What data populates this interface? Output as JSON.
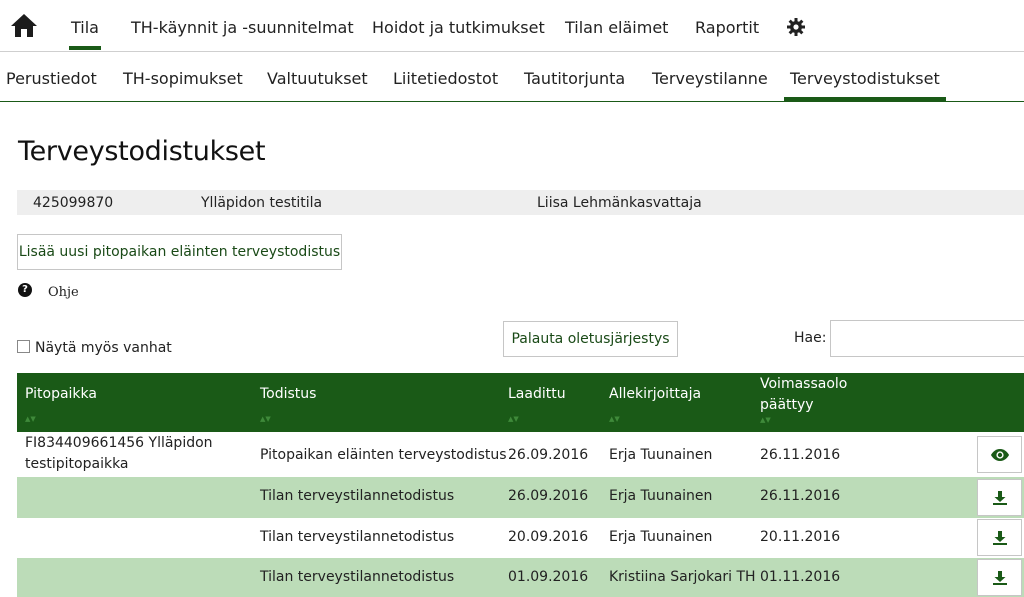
{
  "topnav": {
    "home_icon": "home-icon",
    "items": [
      {
        "label": "Tila",
        "active": true
      },
      {
        "label": "TH-käynnit ja -suunnitelmat"
      },
      {
        "label": "Hoidot ja tutkimukset"
      },
      {
        "label": "Tilan eläimet"
      },
      {
        "label": "Raportit"
      }
    ],
    "settings_icon": "gear-icon"
  },
  "subnav": {
    "items": [
      {
        "label": "Perustiedot"
      },
      {
        "label": "TH-sopimukset"
      },
      {
        "label": "Valtuutukset"
      },
      {
        "label": "Liitetiedostot"
      },
      {
        "label": "Tautitorjunta"
      },
      {
        "label": "Terveystilanne"
      },
      {
        "label": "Terveystodistukset",
        "active": true
      }
    ]
  },
  "page_title": "Terveystodistukset",
  "farm": {
    "id": "425099870",
    "name": "Ylläpidon testitila",
    "owner": "Liisa Lehmänkasvattaja"
  },
  "add_button": "Lisää uusi pitopaikan eläinten terveystodistus",
  "help": {
    "icon": "question-circle-icon",
    "label": "Ohje"
  },
  "show_old": {
    "label": "Näytä myös vanhat",
    "checked": false
  },
  "reset_button": "Palauta oletusjärjestys",
  "search": {
    "label": "Hae:",
    "value": ""
  },
  "table": {
    "headers": {
      "location": "Pitopaikka",
      "certificate": "Todistus",
      "created": "Laadittu",
      "signer": "Allekirjoittaja",
      "valid_line1": "Voimassaolo",
      "valid_line2": "päättyy"
    },
    "rows": [
      {
        "location_line1": "FI834409661456 Ylläpidon",
        "location_line2": "testipitopaikka",
        "certificate": "Pitopaikan eläinten terveystodistus",
        "created": "26.09.2016",
        "signer": "Erja Tuunainen",
        "valid": "26.11.2016",
        "action": "eye-icon"
      },
      {
        "location_line1": "",
        "location_line2": "",
        "certificate": "Tilan terveystilannetodistus",
        "created": "26.09.2016",
        "signer": "Erja Tuunainen",
        "valid": "26.11.2016",
        "action": "download-icon"
      },
      {
        "location_line1": "",
        "location_line2": "",
        "certificate": "Tilan terveystilannetodistus",
        "created": "20.09.2016",
        "signer": "Erja Tuunainen",
        "valid": "20.11.2016",
        "action": "download-icon"
      },
      {
        "location_line1": "",
        "location_line2": "",
        "certificate": "Tilan terveystilannetodistus",
        "created": "01.09.2016",
        "signer": "Kristiina Sarjokari TH",
        "valid": "01.11.2016",
        "action": "download-icon"
      }
    ]
  },
  "colors": {
    "primary": "#1a5a17",
    "row_alt": "#bcdcb8",
    "infobar": "#eeeeee"
  }
}
